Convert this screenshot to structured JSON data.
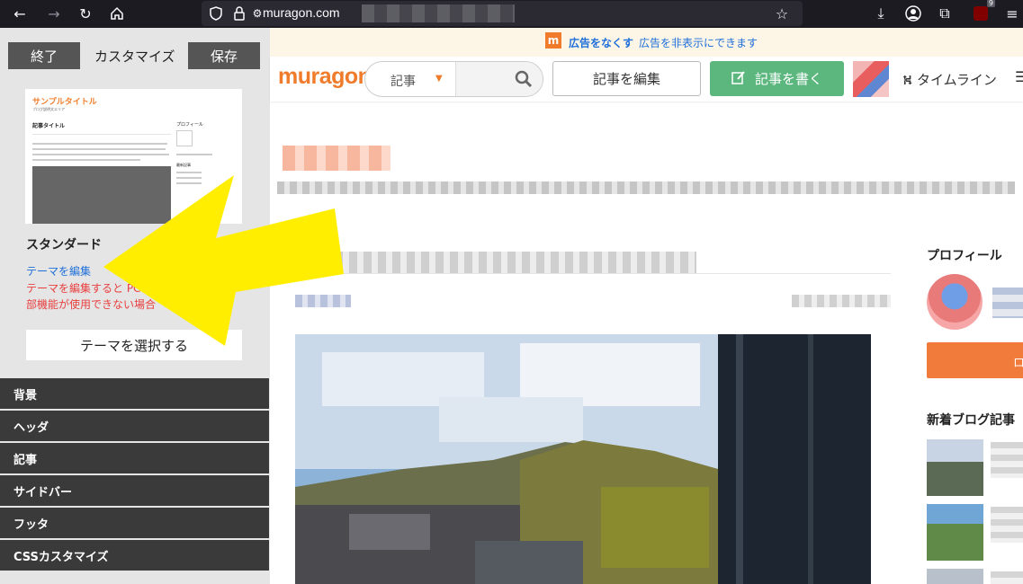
{
  "browser": {
    "url": "muragon.com",
    "extension_badge": "9"
  },
  "customize_panel": {
    "exit_label": "終了",
    "title": "カスタマイズ",
    "save_label": "保存",
    "thumbnail": {
      "sample_title": "サンプルタイトル",
      "sample_subtitle": "ブログ説明文エリア",
      "article_title": "記事タイトル",
      "sidebar_title": "プロフィール",
      "sidebar_new": "最新記事"
    },
    "theme_name": "スタンダード",
    "edit_theme_link": "テーマを編集",
    "warning_line1": "テーマを編集すると PC",
    "warning_line2": "部機能が使用できない場合",
    "select_theme_label": "テーマを選択する",
    "menu": [
      "背景",
      "ヘッダ",
      "記事",
      "サイドバー",
      "フッタ",
      "CSSカスタマイズ"
    ]
  },
  "site": {
    "ad_icon": "m",
    "ad_strong": "広告をなくす",
    "ad_text": "広告を非表示にできます",
    "logo": "muragon",
    "search_category": "記事",
    "edit_articles_label": "記事を編集",
    "write_article_label": "記事を書く",
    "timeline_label": "タイムライン",
    "profile_heading": "プロフィール",
    "follow_label": "ロ",
    "new_posts_heading": "新着ブログ記事"
  },
  "colors": {
    "accent_orange": "#f07b2a",
    "write_green": "#5cb77f",
    "arrow_yellow": "#ffee00",
    "link_blue": "#1e6fd9",
    "warning_red": "#e83e3e"
  },
  "icons": [
    "back-icon",
    "forward-icon",
    "reload-icon",
    "home-icon",
    "shield-icon",
    "lock-icon",
    "permissions-icon",
    "star-icon",
    "download-icon",
    "account-icon",
    "extensions-icon",
    "ublock-icon",
    "search-icon",
    "edit-icon",
    "timeline-icon",
    "hamburger-icon"
  ]
}
